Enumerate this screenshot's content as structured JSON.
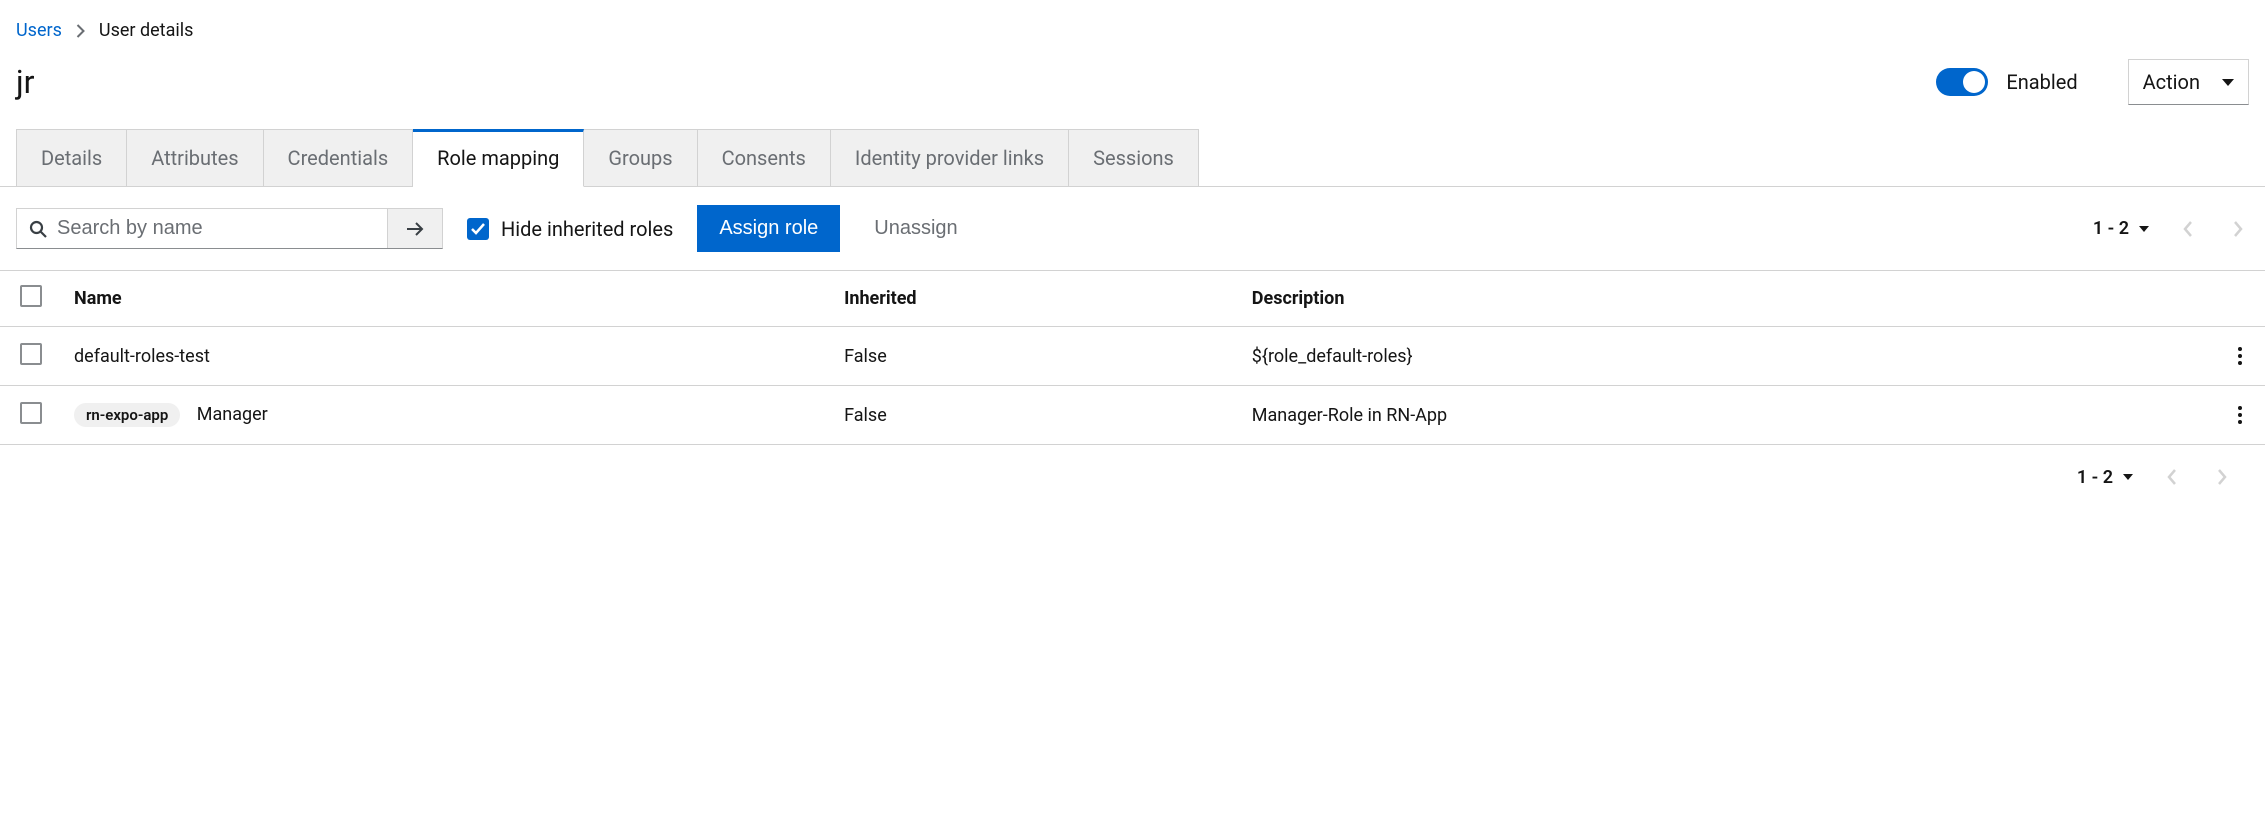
{
  "breadcrumb": {
    "root": "Users",
    "current": "User details"
  },
  "header": {
    "title": "jr",
    "enabled_label": "Enabled",
    "action_label": "Action"
  },
  "tabs": [
    {
      "label": "Details",
      "active": false
    },
    {
      "label": "Attributes",
      "active": false
    },
    {
      "label": "Credentials",
      "active": false
    },
    {
      "label": "Role mapping",
      "active": true
    },
    {
      "label": "Groups",
      "active": false
    },
    {
      "label": "Consents",
      "active": false
    },
    {
      "label": "Identity provider links",
      "active": false
    },
    {
      "label": "Sessions",
      "active": false
    }
  ],
  "toolbar": {
    "search_placeholder": "Search by name",
    "hide_inherited_label": "Hide inherited roles",
    "assign_label": "Assign role",
    "unassign_label": "Unassign"
  },
  "pager": {
    "range": "1 - 2"
  },
  "table": {
    "headers": {
      "name": "Name",
      "inherited": "Inherited",
      "description": "Description"
    },
    "rows": [
      {
        "chip": null,
        "name": "default-roles-test",
        "inherited": "False",
        "description": "${role_default-roles}"
      },
      {
        "chip": "rn-expo-app",
        "name": "Manager",
        "inherited": "False",
        "description": "Manager-Role in RN-App"
      }
    ]
  }
}
